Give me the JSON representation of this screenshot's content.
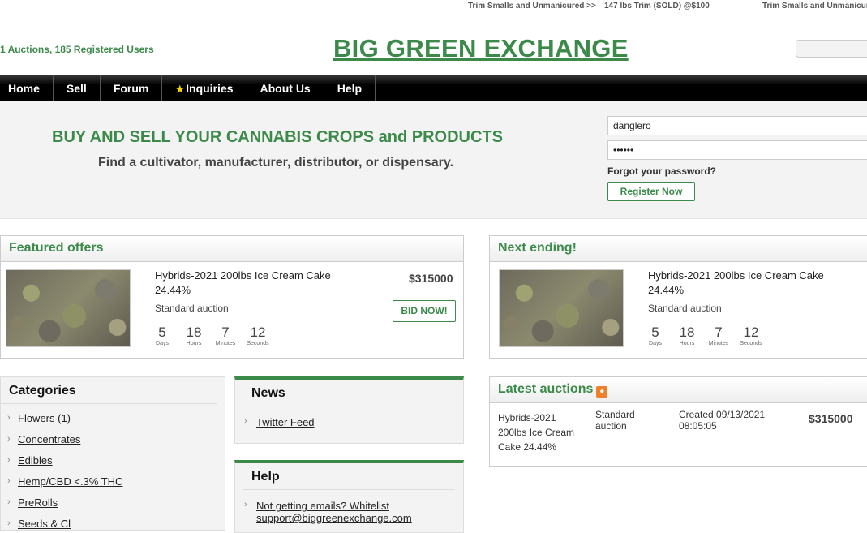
{
  "ticker": {
    "item1": "Trim Smalls and Unmanicured >>",
    "item2": "147 lbs Trim (SOLD) @$100",
    "item3": "Trim Smalls and Unmanicur"
  },
  "header": {
    "stats": "1 Auctions, 185 Registered Users",
    "logo": "BIG GREEN EXCHANGE"
  },
  "nav": {
    "home": "Home",
    "sell": "Sell",
    "forum": "Forum",
    "inquiries": "Inquiries",
    "about": "About Us",
    "help": "Help"
  },
  "banner": {
    "title": "BUY AND SELL YOUR CANNABIS CROPS and PRODUCTS",
    "subtitle": "Find a cultivator, manufacturer, distributor, or dispensary."
  },
  "login": {
    "username": "danglero",
    "password": "••••••",
    "forgot": "Forgot your password?",
    "register": "Register Now"
  },
  "featured": {
    "heading": "Featured offers",
    "title": "Hybrids-2021 200lbs Ice Cream Cake 24.44%",
    "type": "Standard auction",
    "price": "$315000",
    "bid": "BID NOW!",
    "countdown": [
      {
        "n": "5",
        "l": "Days"
      },
      {
        "n": "18",
        "l": "Hours"
      },
      {
        "n": "7",
        "l": "Minutes"
      },
      {
        "n": "12",
        "l": "Seconds"
      }
    ]
  },
  "ending": {
    "heading": "Next ending!",
    "title": "Hybrids-2021 200lbs Ice Cream Cake 24.44%",
    "type": "Standard auction",
    "countdown": [
      {
        "n": "5",
        "l": "Days"
      },
      {
        "n": "18",
        "l": "Hours"
      },
      {
        "n": "7",
        "l": "Minutes"
      },
      {
        "n": "12",
        "l": "Seconds"
      }
    ]
  },
  "categories": {
    "heading": "Categories",
    "items": [
      "Flowers (1)",
      "Concentrates",
      "Edibles",
      "Hemp/CBD <.3% THC",
      "PreRolls",
      "Seeds & Cl"
    ]
  },
  "news": {
    "heading": "News",
    "items": [
      "Twitter Feed"
    ]
  },
  "help": {
    "heading": "Help",
    "items": [
      "Not getting emails? Whitelist support@biggreenexchange.com"
    ]
  },
  "latest": {
    "heading": "Latest auctions",
    "title": "Hybrids-2021 200lbs Ice Cream Cake 24.44%",
    "type": "Standard auction",
    "created": "Created 09/13/2021 08:05:05",
    "price": "$315000"
  },
  "icons": {
    "nav_star": "star-icon",
    "list_arrow": "chevron-right-icon",
    "rss": "rss-icon"
  },
  "colors": {
    "brand_green": "#3c8a4a",
    "nav_bg": "#000000",
    "star": "#f5d300"
  }
}
